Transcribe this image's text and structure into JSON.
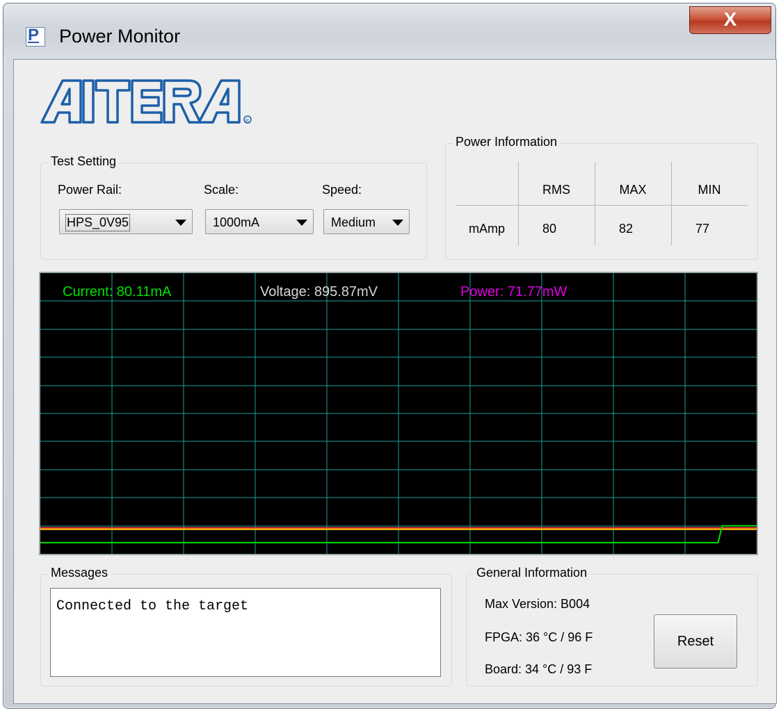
{
  "window": {
    "title": "Power Monitor",
    "close_label": "X"
  },
  "logo": {
    "text": "ALTERA"
  },
  "test_setting": {
    "legend": "Test Setting",
    "power_rail_label": "Power Rail:",
    "power_rail_value": "HPS_0V95",
    "scale_label": "Scale:",
    "scale_value": "1000mA",
    "speed_label": "Speed:",
    "speed_value": "Medium"
  },
  "power_info": {
    "legend": "Power Information",
    "columns": [
      "RMS",
      "MAX",
      "MIN"
    ],
    "row_label": "mAmp",
    "values": [
      "80",
      "82",
      "77"
    ]
  },
  "scope": {
    "current_label": "Current: 80.11mA",
    "voltage_label": "Voltage: 895.87mV",
    "power_label": "Power: 71.77mW",
    "colors": {
      "current": "#00e000",
      "voltage": "#d8d8d8",
      "power": "#e000e0",
      "grid": "#1aa0a0",
      "trace_red": "#ff3a3a",
      "trace_yellow": "#ffd000",
      "trace_green": "#00e000"
    },
    "trace": {
      "green_level_low": 0.04,
      "green_level_high": 0.1,
      "green_step_at": 0.95,
      "redyellow_level": 0.09
    }
  },
  "messages": {
    "legend": "Messages",
    "text": "Connected to the target"
  },
  "general_info": {
    "legend": "General Information",
    "max_version": "Max Version:  B004",
    "fpga": "FPGA:  36 °C / 96 F",
    "board": "Board:  34 °C / 93 F",
    "reset_label": "Reset"
  }
}
